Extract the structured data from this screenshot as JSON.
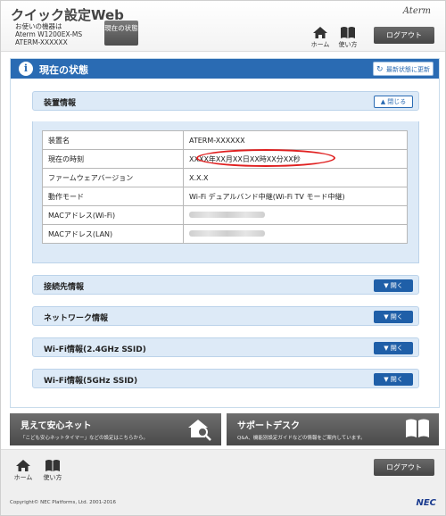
{
  "header": {
    "app_title": "クイック設定Web",
    "device_label": "お使いの機器は",
    "device_model": "Aterm W1200EX-MS",
    "device_name": "ATERM-XXXXXX",
    "status_button": "現在の状態",
    "brand": "Aterm",
    "home_label": "ホーム",
    "help_label": "使い方",
    "logout_label": "ログアウト"
  },
  "main": {
    "title": "現在の状態",
    "refresh_label": "最新状態に更新",
    "device_info": {
      "label": "装置情報",
      "close_label": "閉じる",
      "rows": [
        {
          "key": "装置名",
          "value": "ATERM-XXXXXX"
        },
        {
          "key": "現在の時刻",
          "value": "XXXX年XX月XX日XX時XX分XX秒"
        },
        {
          "key": "ファームウェアバージョン",
          "value": "X.X.X"
        },
        {
          "key": "動作モード",
          "value": "Wi-Fi デュアルバンド中継(Wi-Fi TV モード中継)"
        },
        {
          "key": "MACアドレス(Wi-Fi)",
          "value": ""
        },
        {
          "key": "MACアドレス(LAN)",
          "value": ""
        }
      ]
    },
    "sections": [
      {
        "label": "接続先情報",
        "open_label": "開く"
      },
      {
        "label": "ネットワーク情報",
        "open_label": "開く"
      },
      {
        "label": "Wi-Fi情報(2.4GHz SSID)",
        "open_label": "開く"
      },
      {
        "label": "Wi-Fi情報(5GHz SSID)",
        "open_label": "開く"
      }
    ]
  },
  "tiles": {
    "mimamori": {
      "title": "見えて安心ネット",
      "desc": "「こども安心ネットタイマー」などの設定はこちらから。"
    },
    "support": {
      "title": "サポートデスク",
      "desc": "Q&A、機能別設定ガイドなどの情報をご案内しています。"
    }
  },
  "footer": {
    "home_label": "ホーム",
    "help_label": "使い方",
    "logout_label": "ログアウト",
    "copyright": "Copyright© NEC Platforms, Ltd. 2001-2016",
    "logo": "NEC"
  },
  "colors": {
    "accent": "#2a6bb3",
    "highlight": "#e02020"
  }
}
